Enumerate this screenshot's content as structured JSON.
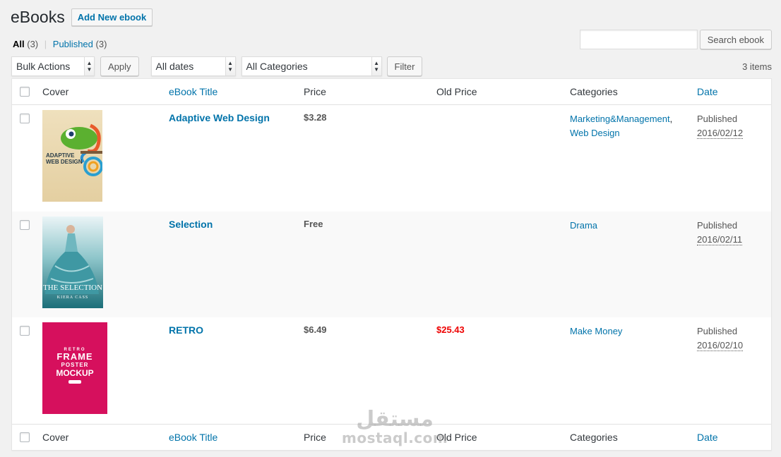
{
  "header": {
    "title": "eBooks",
    "add_new_label": "Add New ebook"
  },
  "filters": {
    "all_label": "All",
    "all_count": "(3)",
    "sep": "|",
    "published_label": "Published",
    "published_count": "(3)"
  },
  "search": {
    "button_label": "Search ebook",
    "value": ""
  },
  "tablenav": {
    "bulk_actions": "Bulk Actions",
    "apply_label": "Apply",
    "dates": "All dates",
    "categories": "All Categories",
    "filter_label": "Filter",
    "items_count": "3 items"
  },
  "columns": {
    "cover": "Cover",
    "title": "eBook Title",
    "price": "Price",
    "old_price": "Old Price",
    "categories": "Categories",
    "date": "Date"
  },
  "rows": [
    {
      "title": "Adaptive Web Design",
      "price": "$3.28",
      "old_price": "",
      "categories": [
        "Marketing&Management",
        "Web Design"
      ],
      "status": "Published",
      "date": "2016/02/12",
      "cover_text": [
        "ADAPTIVE",
        "WEB DESIGN"
      ]
    },
    {
      "title": "Selection",
      "price": "Free",
      "old_price": "",
      "categories": [
        "Drama"
      ],
      "status": "Published",
      "date": "2016/02/11",
      "cover_text": [
        "THE SELECTION",
        "KIERA CASS"
      ]
    },
    {
      "title": "RETRO",
      "price": "$6.49",
      "old_price": "$25.43",
      "categories": [
        "Make Money"
      ],
      "status": "Published",
      "date": "2016/02/10",
      "cover_text": [
        "RETRO",
        "FRAME",
        "POSTER",
        "MOCKUP"
      ]
    }
  ],
  "watermark": {
    "arabic": "مستقل",
    "latin": "mostaql.com"
  },
  "colors": {
    "link": "#0073aa",
    "old_price": "#e00000",
    "retro_cover": "#d6105d"
  }
}
